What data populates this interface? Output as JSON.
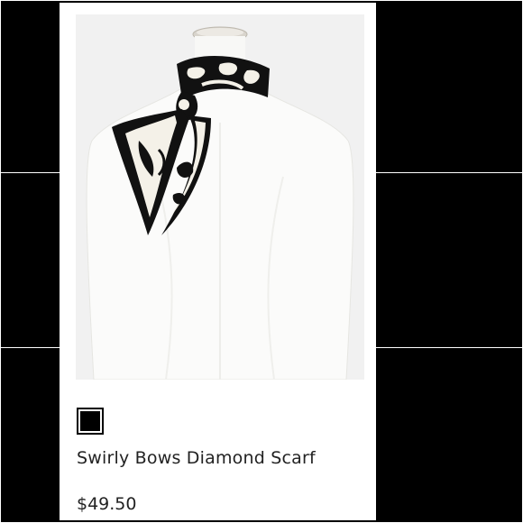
{
  "product": {
    "name": "Swirly Bows Diamond Scarf",
    "price": "$49.50",
    "swatches": [
      {
        "color": "#000000",
        "selected": true
      }
    ],
    "image_icon": "scarf-on-mannequin-image"
  }
}
